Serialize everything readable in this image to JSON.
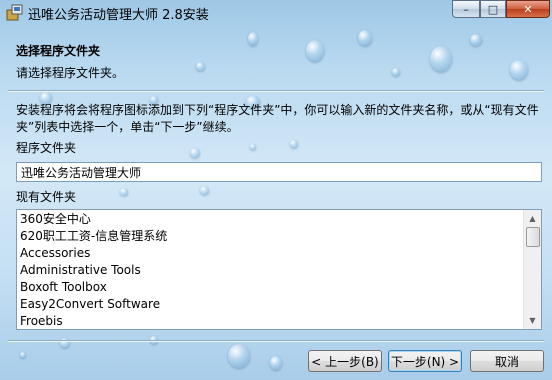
{
  "window": {
    "title": "迅唯公务活动管理大师 2.8安装",
    "controls": {
      "minimize": "–",
      "maximize": "□",
      "close": "✕"
    }
  },
  "header": {
    "title": "选择程序文件夹",
    "subtitle": "请选择程序文件夹。"
  },
  "body": {
    "description": "安装程序将会将程序图标添加到下列“程序文件夹”中，你可以输入新的文件夹名称，或从“现有文件夹”列表中选择一个，单击“下一步”继续。",
    "folder_label": "程序文件夹",
    "folder_value": "迅唯公务活动管理大师",
    "existing_label": "现有文件夹",
    "existing_folders": [
      "360安全中心",
      "620职工工资-信息管理系统",
      "Accessories",
      "Administrative Tools",
      "Boxoft Toolbox",
      "Easy2Convert Software",
      "Froebis"
    ]
  },
  "buttons": {
    "back": "< 上一步(B)",
    "next": "下一步(N) >",
    "cancel": "取消"
  }
}
